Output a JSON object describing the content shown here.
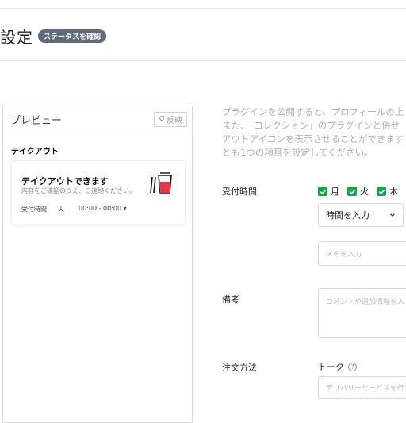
{
  "header": {
    "title": "設定",
    "status_badge": "ステータスを確認"
  },
  "preview": {
    "title": "プレビュー",
    "refresh_label": "反映",
    "section_label": "テイクアウト",
    "card": {
      "title": "テイクアウトできます",
      "subtitle": "内容をご確認のうえ、ご連絡ください。",
      "hours_label": "受付時間",
      "day": "火",
      "time": "00:00 - 00:00 ▾"
    }
  },
  "description": {
    "lines": [
      "プラグインを公開すると、プロフィールの上",
      "また、「コレクション」のプラグインと併せ",
      "アウトアイコンを表示させることができます",
      "とも1つの項目を設定してください。"
    ]
  },
  "form": {
    "hours_label": "受付時間",
    "days": [
      {
        "label": "月",
        "checked": true
      },
      {
        "label": "火",
        "checked": true
      },
      {
        "label": "木",
        "checked": true
      }
    ],
    "time_select_value": "時間を入力",
    "memo_placeholder": "メモを入力",
    "note_label": "備考",
    "note_placeholder": "コメントや追加情報を入",
    "order_label": "注文方法",
    "talk_label": "トーク",
    "delivery_placeholder": "デリバリーサービスを行"
  },
  "colors": {
    "accent_green": "#17a34a",
    "badge_gray": "#5f6b7a",
    "cup_red": "#e8364a"
  }
}
